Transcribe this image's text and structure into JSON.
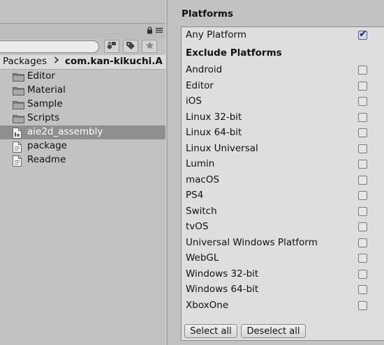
{
  "project_pane": {
    "search": {
      "value": "",
      "placeholder": ""
    },
    "toolbar_icons": [
      "lock-icon",
      "menu-icon"
    ],
    "search_buttons": [
      "filter-by-type-icon",
      "filter-by-label-icon",
      "favorite-star-icon"
    ],
    "breadcrumb": [
      "Packages",
      "com.kan-kikuchi.A"
    ],
    "files": [
      {
        "name": "Editor",
        "icon": "folder-icon",
        "selected": false
      },
      {
        "name": "Material",
        "icon": "folder-icon",
        "selected": false
      },
      {
        "name": "Sample",
        "icon": "folder-icon",
        "selected": false
      },
      {
        "name": "Scripts",
        "icon": "folder-icon",
        "selected": false
      },
      {
        "name": "aie2d_assembly",
        "icon": "assembly-file-icon",
        "selected": true
      },
      {
        "name": "package",
        "icon": "document-icon",
        "selected": false
      },
      {
        "name": "Readme",
        "icon": "document-icon",
        "selected": false
      }
    ]
  },
  "inspector": {
    "title": "Platforms",
    "any_platform": {
      "label": "Any Platform",
      "checked": true
    },
    "exclude_heading": "Exclude Platforms",
    "platforms": [
      {
        "label": "Android",
        "checked": false
      },
      {
        "label": "Editor",
        "checked": false
      },
      {
        "label": "iOS",
        "checked": false
      },
      {
        "label": "Linux 32-bit",
        "checked": false
      },
      {
        "label": "Linux 64-bit",
        "checked": false
      },
      {
        "label": "Linux Universal",
        "checked": false
      },
      {
        "label": "Lumin",
        "checked": false
      },
      {
        "label": "macOS",
        "checked": false
      },
      {
        "label": "PS4",
        "checked": false
      },
      {
        "label": "Switch",
        "checked": false
      },
      {
        "label": "tvOS",
        "checked": false
      },
      {
        "label": "Universal Windows Platform",
        "checked": false
      },
      {
        "label": "WebGL",
        "checked": false
      },
      {
        "label": "Windows 32-bit",
        "checked": false
      },
      {
        "label": "Windows 64-bit",
        "checked": false
      },
      {
        "label": "XboxOne",
        "checked": false
      }
    ],
    "select_all_label": "Select all",
    "deselect_all_label": "Deselect all"
  }
}
